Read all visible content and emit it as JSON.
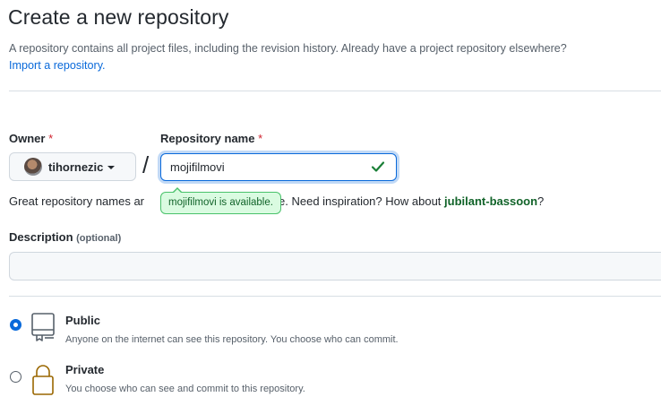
{
  "header": {
    "title": "Create a new repository",
    "subtitle": "A repository contains all project files, including the revision history. Already have a project repository elsewhere?",
    "import_link": "Import a repository."
  },
  "owner": {
    "label": "Owner",
    "required_mark": "*",
    "value": "tihornezic"
  },
  "repo_name": {
    "label": "Repository name",
    "required_mark": "*",
    "value": "mojifilmovi",
    "separator": "/",
    "availability_tooltip": "mojifilmovi is available."
  },
  "hint": {
    "prefix": "Great repository names ar",
    "middle": "e. Need inspiration? How about",
    "suggestion": "jubilant-bassoon",
    "suffix": "?"
  },
  "description": {
    "label": "Description",
    "optional": "(optional)",
    "value": ""
  },
  "visibility": {
    "options": [
      {
        "title": "Public",
        "description": "Anyone on the internet can see this repository. You choose who can commit.",
        "selected": true,
        "icon": "repo-icon"
      },
      {
        "title": "Private",
        "description": "You choose who can see and commit to this repository.",
        "selected": false,
        "icon": "lock-icon"
      }
    ]
  },
  "colors": {
    "link": "#0969da",
    "success": "#1a7f37",
    "required": "#cf222e"
  }
}
